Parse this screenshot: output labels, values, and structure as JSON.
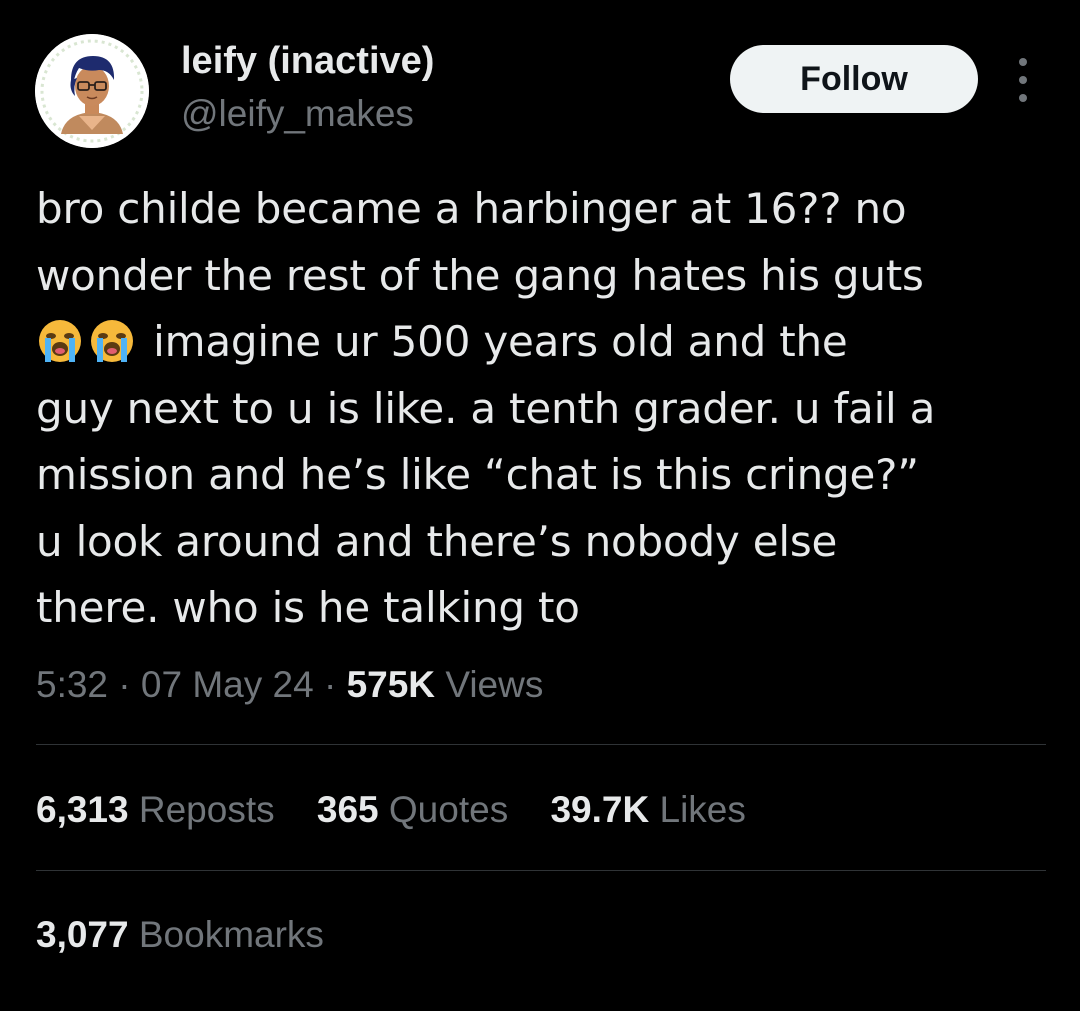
{
  "author": {
    "display_name": "leify (inactive)",
    "handle": "@leify_makes",
    "avatar_icon": "avatar-illustration"
  },
  "follow_label": "Follow",
  "more_icon": "more-options-icon",
  "tweet": {
    "lines": [
      "bro childe became a harbinger at 16?? no",
      "wonder the rest of the gang hates his guts",
      "imagine ur 500 years old and the",
      "guy next to u is like. a tenth grader. u fail a",
      "mission and he’s like “chat is this cringe?”",
      "u look around and there’s nobody else",
      "there. who is he talking to"
    ],
    "emoji": "loudly-crying-face-emoji"
  },
  "meta": {
    "time": "5:32",
    "sep": "·",
    "date": "07 May 24",
    "views_count": "575K",
    "views_label": "Views"
  },
  "stats": {
    "reposts_count": "6,313",
    "reposts_label": "Reposts",
    "quotes_count": "365",
    "quotes_label": "Quotes",
    "likes_count": "39.7K",
    "likes_label": "Likes",
    "bookmarks_count": "3,077",
    "bookmarks_label": "Bookmarks"
  },
  "colors": {
    "background": "#000000",
    "text_primary": "#e7e9ea",
    "text_secondary": "#71767b",
    "divider": "#2f3336",
    "button_bg": "#eff3f4",
    "button_text": "#0f1419"
  }
}
